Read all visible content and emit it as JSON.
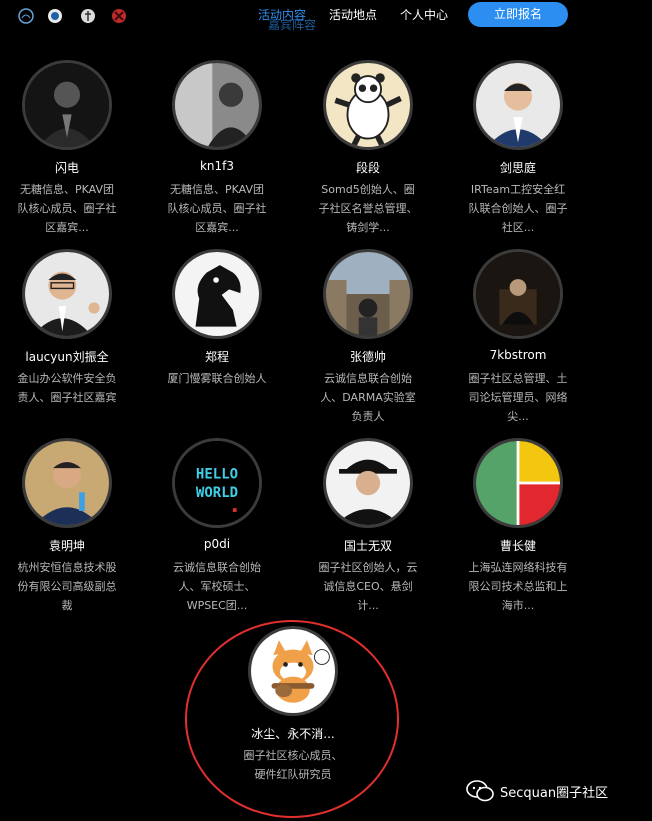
{
  "nav": {
    "items": [
      "活动内容",
      "活动地点",
      "个人中心"
    ],
    "active_subtitle": "嘉宾阵容",
    "signup_label": "立即报名"
  },
  "sponsors": [
    "sponsor-logo-1",
    "sponsor-logo-2",
    "sponsor-logo-3",
    "sponsor-logo-4"
  ],
  "speakers": [
    {
      "name": "闪电",
      "desc": "无糖信息、PKAV团队核心成员、圈子社区嘉宾..."
    },
    {
      "name": "kn1f3",
      "desc": "无糖信息、PKAV团队核心成员、圈子社区嘉宾..."
    },
    {
      "name": "段段",
      "desc": "Somd5创始人、圈子社区名誉总管理、铸剑学..."
    },
    {
      "name": "剑思庭",
      "desc": "IRTeam工控安全红队联合创始人、圈子社区..."
    },
    {
      "name": "laucyun刘振全",
      "desc": "金山办公软件安全负责人、圈子社区嘉宾"
    },
    {
      "name": "郑程",
      "desc": "厦门慢雾联合创始人"
    },
    {
      "name": "张德帅",
      "desc": "云诚信息联合创始人、DARMA实验室负责人"
    },
    {
      "name": "7kbstrom",
      "desc": "圈子社区总管理、土司论坛管理员、网络尖..."
    },
    {
      "name": "袁明坤",
      "desc": "杭州安恒信息技术股份有限公司高级副总裁"
    },
    {
      "name": "p0di",
      "desc": "云诚信息联合创始人、军校硕士、WPSEC团..."
    },
    {
      "name": "国士无双",
      "desc": "圈子社区创始人，云诚信息CEO、悬剑计..."
    },
    {
      "name": "曹长健",
      "desc": "上海弘连网络科技有限公司技术总监和上海市..."
    },
    {
      "name": "冰尘、永不消...",
      "desc": "圈子社区核心成员、硬件红队研究员"
    }
  ],
  "avatar_art": {
    "hello_text": "HELLO",
    "world_text": "WORLD"
  },
  "watermark": {
    "text": "Secquan圈子社区"
  },
  "colors": {
    "accent": "#2b8ef0",
    "highlight": "#e0302e"
  }
}
